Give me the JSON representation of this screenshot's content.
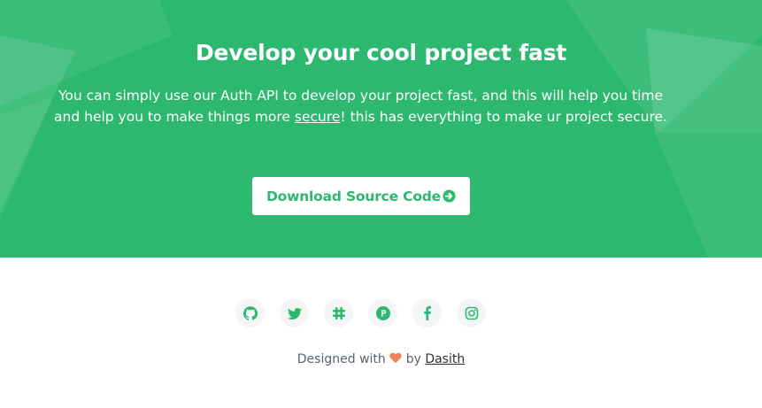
{
  "hero": {
    "title": "Develop your cool project fast",
    "description_pre": "You can simply use our Auth API to develop your project fast, and this will help you time and help you to make things more ",
    "description_link": "secure",
    "description_post": "! this has everything to make ur project secure.",
    "cta_label": "Download Source Code",
    "cta_icon": "arrow-circle-right-icon"
  },
  "socials": [
    {
      "name": "github",
      "icon": "github-icon"
    },
    {
      "name": "twitter",
      "icon": "twitter-icon"
    },
    {
      "name": "slack",
      "icon": "slack-icon"
    },
    {
      "name": "product-hunt",
      "icon": "product-hunt-icon"
    },
    {
      "name": "facebook",
      "icon": "facebook-icon"
    },
    {
      "name": "instagram",
      "icon": "instagram-icon"
    }
  ],
  "footer": {
    "designed_with": "Designed with",
    "by": "by",
    "author": "Dasith"
  },
  "colors": {
    "brand": "#2cb86e",
    "heart": "#f2805a"
  }
}
